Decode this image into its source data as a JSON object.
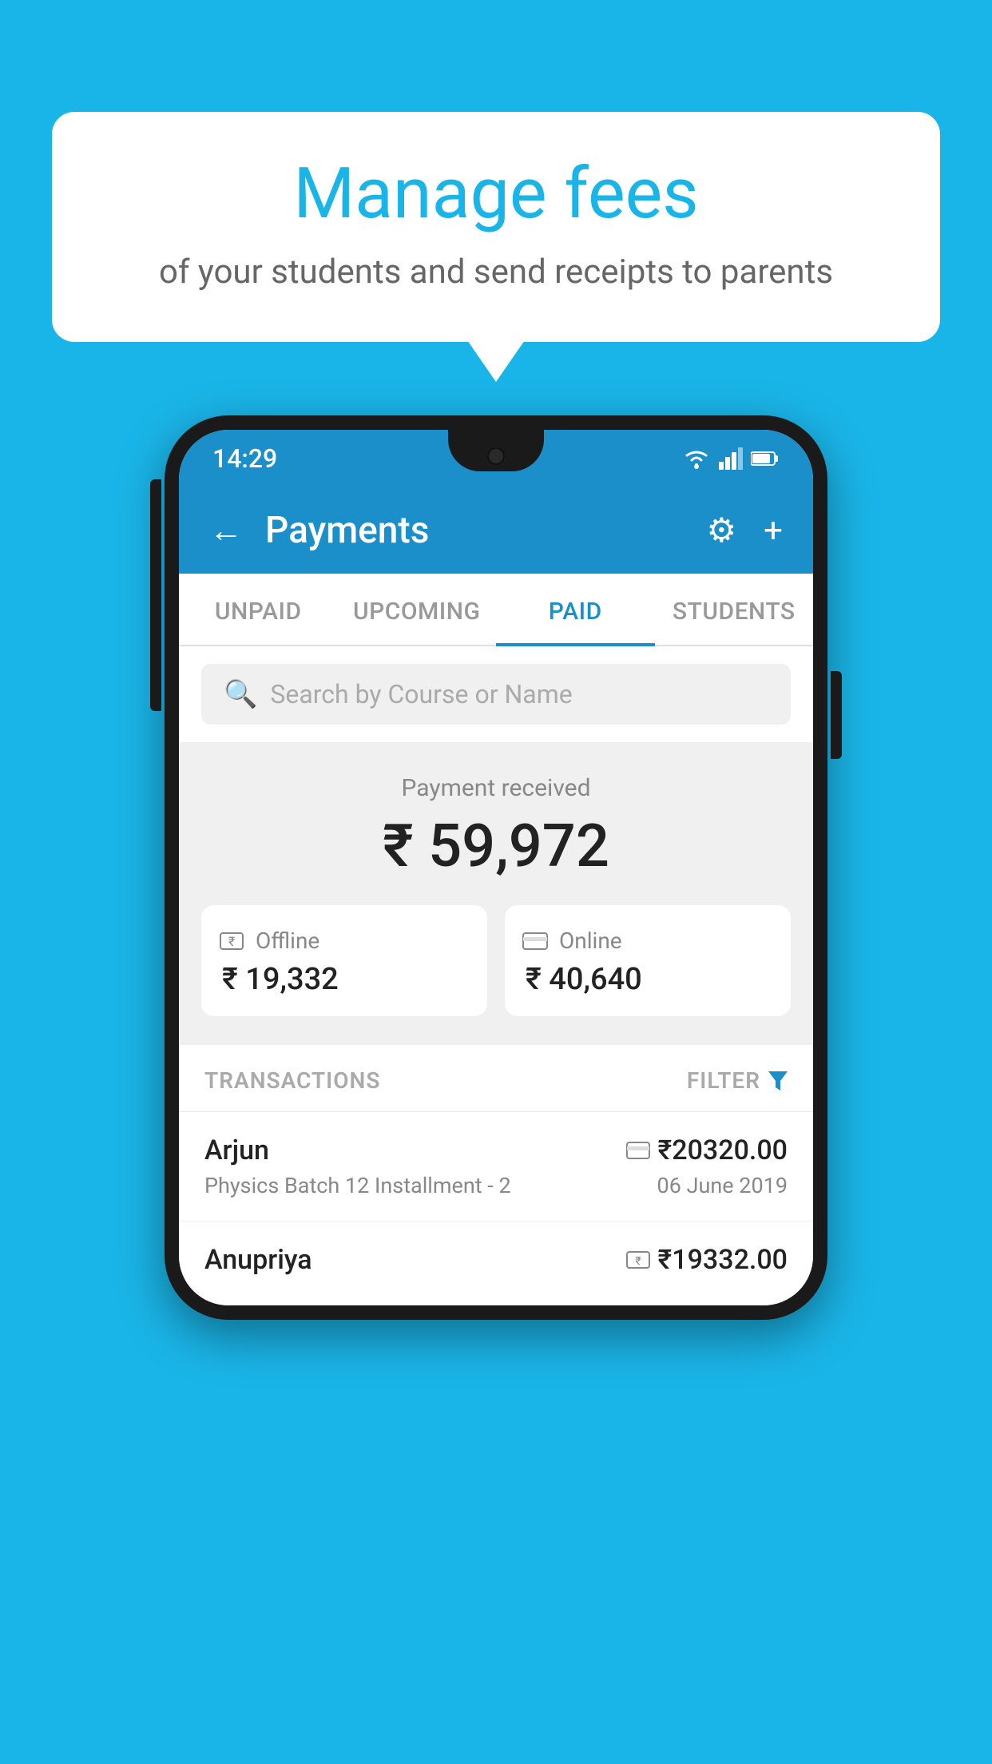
{
  "background_color": "#1ab5e8",
  "speech_bubble": {
    "title": "Manage fees",
    "subtitle": "of your students and send receipts to parents"
  },
  "status_bar": {
    "time": "14:29",
    "wifi": true,
    "signal": true,
    "battery": true
  },
  "header": {
    "title": "Payments",
    "back_label": "←",
    "gear_label": "⚙",
    "plus_label": "+"
  },
  "tabs": [
    {
      "label": "UNPAID",
      "active": false
    },
    {
      "label": "UPCOMING",
      "active": false
    },
    {
      "label": "PAID",
      "active": true
    },
    {
      "label": "STUDENTS",
      "active": false
    }
  ],
  "search": {
    "placeholder": "Search by Course or Name"
  },
  "payment_received": {
    "label": "Payment received",
    "amount": "₹ 59,972",
    "offline": {
      "label": "Offline",
      "amount": "₹ 19,332"
    },
    "online": {
      "label": "Online",
      "amount": "₹ 40,640"
    }
  },
  "transactions_section": {
    "label": "TRANSACTIONS",
    "filter_label": "FILTER"
  },
  "transactions": [
    {
      "name": "Arjun",
      "course": "Physics Batch 12 Installment - 2",
      "amount": "₹20320.00",
      "date": "06 June 2019",
      "icon": "card"
    },
    {
      "name": "Anupriya",
      "course": "",
      "amount": "₹19332.00",
      "date": "",
      "icon": "cash"
    }
  ]
}
